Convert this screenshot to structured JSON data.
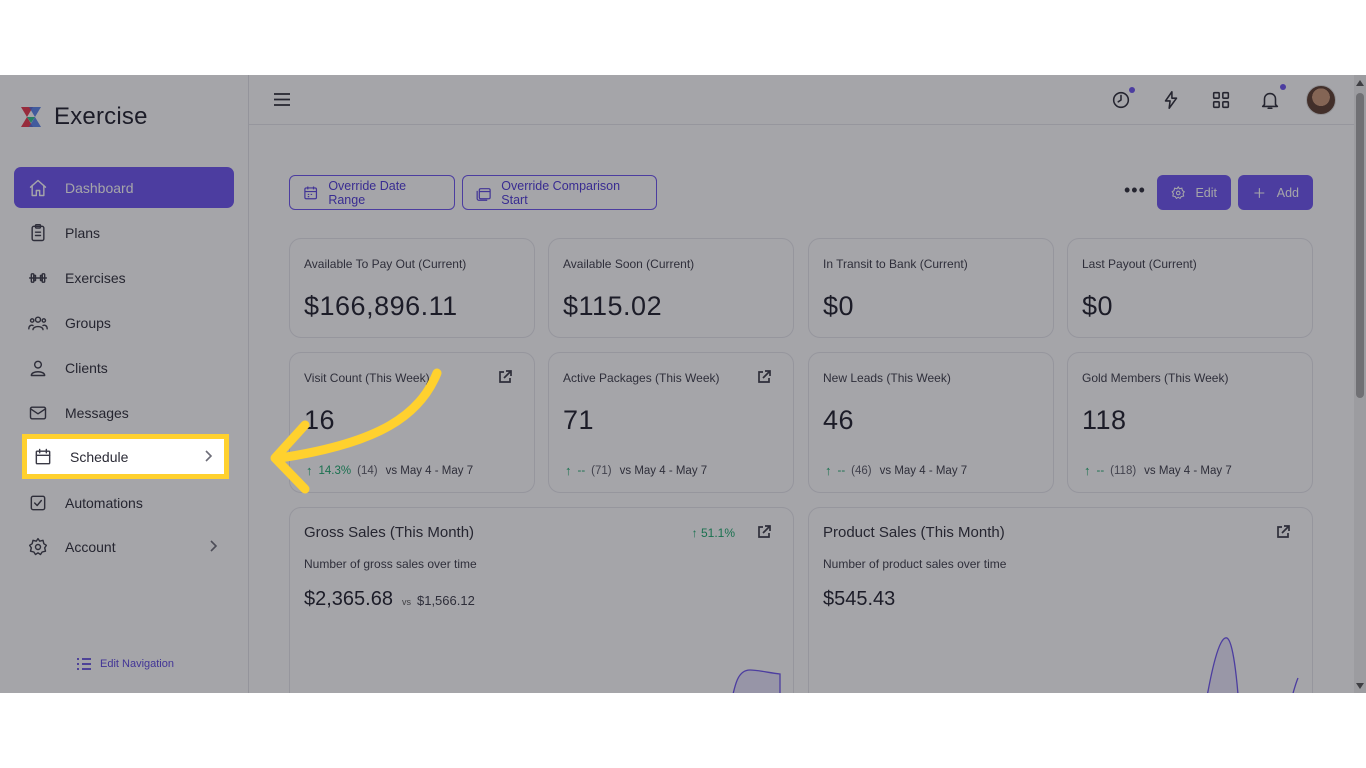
{
  "app": {
    "name": "Exercise"
  },
  "sidebar": {
    "items": [
      {
        "label": "Dashboard",
        "icon": "home-icon"
      },
      {
        "label": "Plans",
        "icon": "clipboard-icon"
      },
      {
        "label": "Exercises",
        "icon": "dumbbell-icon"
      },
      {
        "label": "Groups",
        "icon": "users-icon"
      },
      {
        "label": "Clients",
        "icon": "user-icon"
      },
      {
        "label": "Messages",
        "icon": "mail-icon"
      },
      {
        "label": "Schedule",
        "icon": "calendar-icon"
      },
      {
        "label": "Automations",
        "icon": "checkbox-icon"
      },
      {
        "label": "Account",
        "icon": "gear-icon"
      }
    ],
    "edit_navigation": "Edit Navigation"
  },
  "toolbar": {
    "override_date_range": "Override Date Range",
    "override_comparison_start": "Override Comparison Start",
    "more": "•••",
    "edit": "Edit",
    "add": "Add"
  },
  "stats": [
    {
      "label": "Available To Pay Out (Current)",
      "value": "$166,896.11"
    },
    {
      "label": "Available Soon (Current)",
      "value": "$115.02"
    },
    {
      "label": "In Transit to Bank (Current)",
      "value": "$0"
    },
    {
      "label": "Last Payout (Current)",
      "value": "$0"
    }
  ],
  "weekly": [
    {
      "label": "Visit Count (This Week)",
      "value": "16",
      "pct": "14.3%",
      "count": "(14)",
      "period": "vs May 4 - May 7"
    },
    {
      "label": "Active Packages (This Week)",
      "value": "71",
      "pct": "--",
      "count": "(71)",
      "period": "vs May 4 - May 7"
    },
    {
      "label": "New Leads (This Week)",
      "value": "46",
      "pct": "--",
      "count": "(46)",
      "period": "vs May 4 - May 7"
    },
    {
      "label": "Gold Members (This Week)",
      "value": "118",
      "pct": "--",
      "count": "(118)",
      "period": "vs May 4 - May 7"
    }
  ],
  "gross_sales": {
    "title": "Gross Sales (This Month)",
    "growth": "51.1%",
    "subtitle": "Number of gross sales over time",
    "amount": "$2,365.68",
    "vs": "vs",
    "previous": "$1,566.12"
  },
  "product_sales": {
    "title": "Product Sales (This Month)",
    "subtitle": "Number of product sales over time",
    "amount": "$545.43"
  },
  "colors": {
    "accent": "#6b52f0",
    "highlight": "#ffd12e",
    "positive": "#1aa86b"
  }
}
